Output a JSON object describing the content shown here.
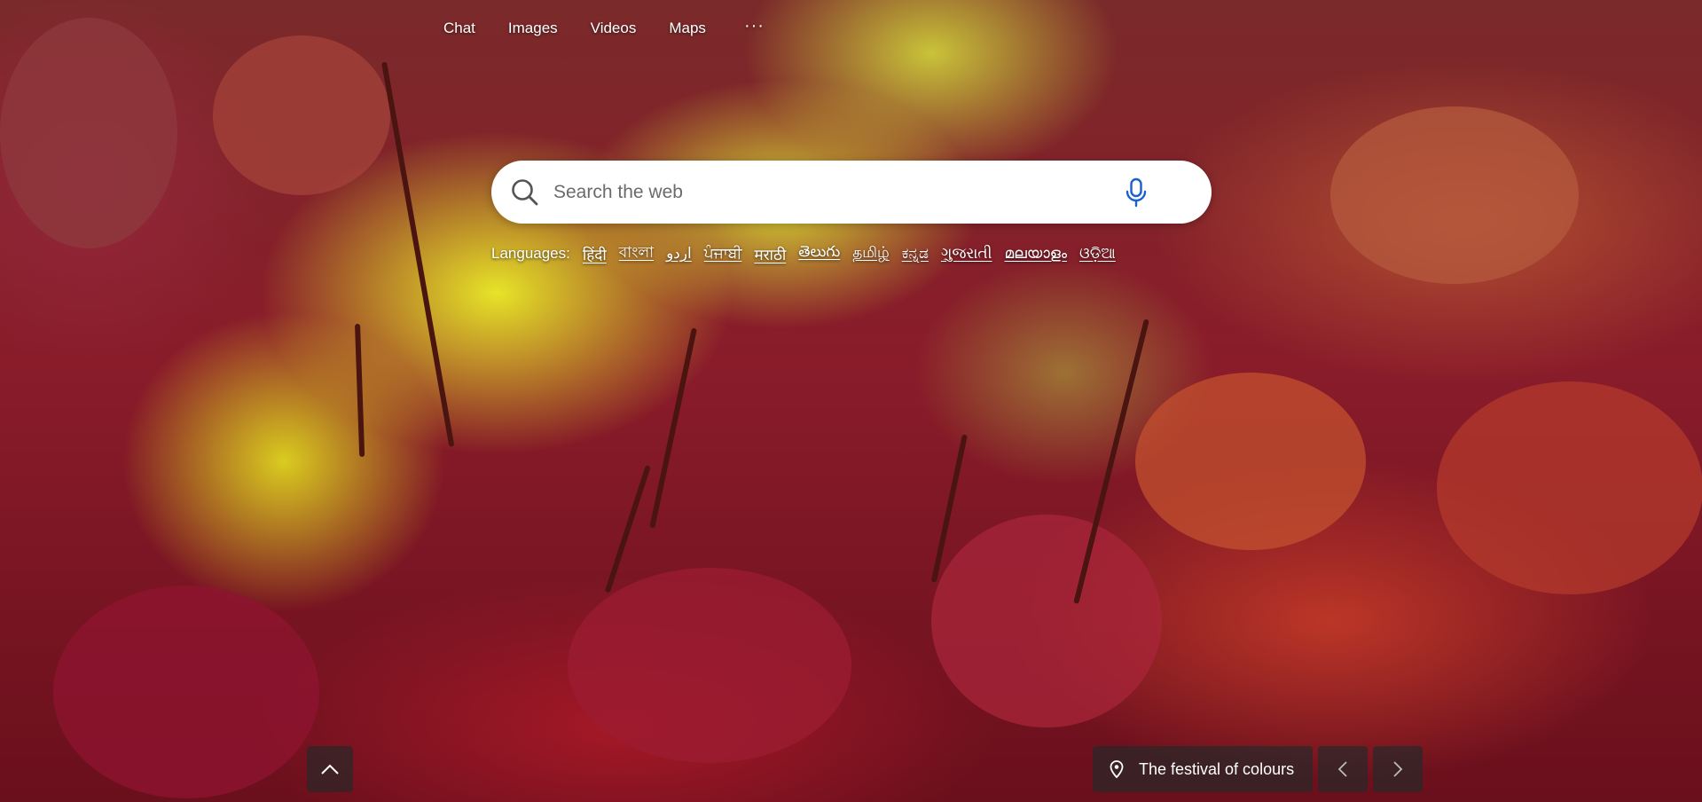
{
  "nav": {
    "items": [
      "Chat",
      "Images",
      "Videos",
      "Maps"
    ],
    "more": "···"
  },
  "search": {
    "placeholder": "Search the web",
    "value": ""
  },
  "languages": {
    "label": "Languages:",
    "items": [
      "हिंदी",
      "বাংলা",
      "اردو",
      "ਪੰਜਾਬੀ",
      "मराठी",
      "తెలుగు",
      "தமிழ்",
      "ಕನ್ನಡ",
      "ગુજરાતી",
      "മലയാളം",
      "ଓଡ଼ିଆ"
    ]
  },
  "caption": {
    "text": "The festival of colours"
  },
  "icons": {
    "search": "search-icon",
    "mic": "microphone-icon",
    "location": "location-pin-icon",
    "scroll_up": "chevron-up-icon",
    "prev": "chevron-left-icon",
    "next": "chevron-right-icon"
  }
}
